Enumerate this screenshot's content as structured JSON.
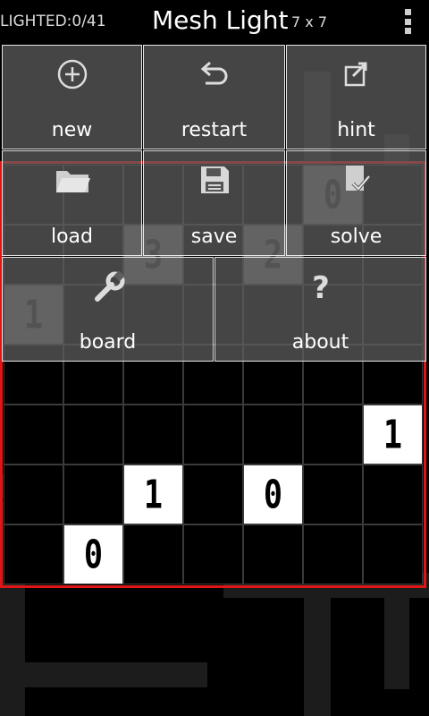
{
  "header": {
    "lighted": "LIGHTED:0/41",
    "title": "Mesh Light",
    "size": "7 x 7",
    "overflow_icon": "overflow-menu-icon"
  },
  "menu": {
    "items": [
      {
        "label": "new",
        "icon": "add-circle-icon"
      },
      {
        "label": "restart",
        "icon": "undo-arrow-icon"
      },
      {
        "label": "hint",
        "icon": "share-arrow-icon"
      },
      {
        "label": "load",
        "icon": "folder-icon"
      },
      {
        "label": "save",
        "icon": "floppy-disk-icon"
      },
      {
        "label": "solve",
        "icon": "check-document-icon"
      },
      {
        "label": "board",
        "icon": "wrench-icon"
      },
      {
        "label": "about",
        "icon": "question-icon"
      }
    ]
  },
  "board": {
    "rows": 7,
    "cols": 7,
    "frame_color": "#e01515",
    "cells": [
      {
        "row": 0,
        "col": 5,
        "state": "dim",
        "digit": "0"
      },
      {
        "row": 1,
        "col": 2,
        "state": "dim",
        "digit": "3"
      },
      {
        "row": 1,
        "col": 4,
        "state": "dim",
        "digit": "2"
      },
      {
        "row": 2,
        "col": 0,
        "state": "dim",
        "digit": "1"
      },
      {
        "row": 4,
        "col": 6,
        "state": "lit",
        "digit": "1"
      },
      {
        "row": 5,
        "col": 2,
        "state": "lit",
        "digit": "1"
      },
      {
        "row": 5,
        "col": 4,
        "state": "lit",
        "digit": "0"
      },
      {
        "row": 6,
        "col": 1,
        "state": "lit",
        "digit": "0"
      }
    ]
  }
}
